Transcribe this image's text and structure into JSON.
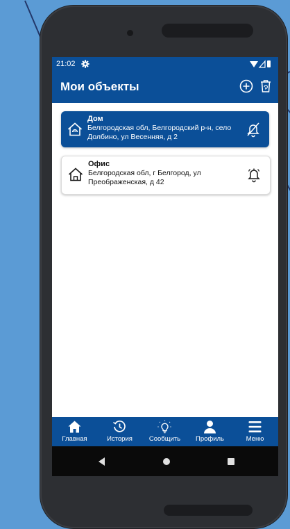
{
  "status_bar": {
    "time": "21:02"
  },
  "header": {
    "title": "Мои объекты"
  },
  "objects": [
    {
      "name": "Дом",
      "address": "Белгородская обл, Белгородский р-н, село Долбино, ул Весенняя, д 2",
      "alerts": "off"
    },
    {
      "name": "Офис",
      "address": "Белгородская обл, г Белгород, ул Преображенская, д 42",
      "alerts": "on"
    }
  ],
  "nav": [
    {
      "label": "Главная",
      "icon": "home-icon"
    },
    {
      "label": "История",
      "icon": "history-icon"
    },
    {
      "label": "Сообщить",
      "icon": "report-icon"
    },
    {
      "label": "Профиль",
      "icon": "profile-icon"
    },
    {
      "label": "Меню",
      "icon": "menu-icon"
    }
  ],
  "colors": {
    "primary": "#0b4f98",
    "background": "#5b9bd5",
    "phone": "#2d2f33"
  }
}
